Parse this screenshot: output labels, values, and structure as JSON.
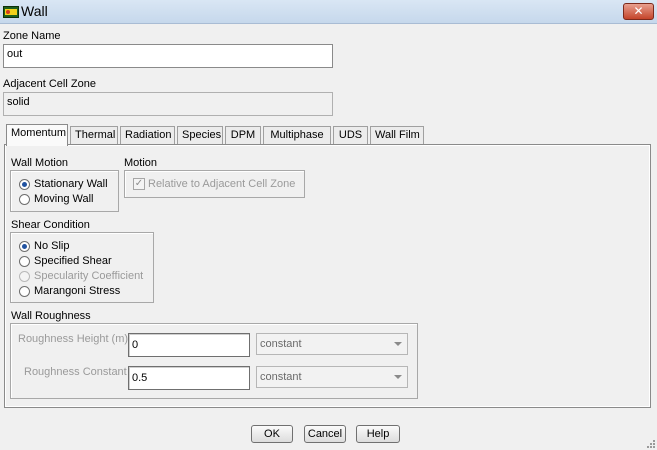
{
  "window": {
    "title": "Wall",
    "close_label": "✕"
  },
  "zone_name": {
    "label": "Zone Name",
    "value": "out"
  },
  "adjacent_cell_zone": {
    "label": "Adjacent Cell Zone",
    "value": "solid"
  },
  "tabs": [
    {
      "label": "Momentum",
      "active": true
    },
    {
      "label": "Thermal"
    },
    {
      "label": "Radiation"
    },
    {
      "label": "Species"
    },
    {
      "label": "DPM"
    },
    {
      "label": "Multiphase"
    },
    {
      "label": "UDS"
    },
    {
      "label": "Wall Film"
    }
  ],
  "momentum": {
    "wall_motion": {
      "label": "Wall Motion",
      "options": [
        "Stationary Wall",
        "Moving Wall"
      ],
      "selected": "Stationary Wall"
    },
    "motion": {
      "label": "Motion",
      "relative_label": "Relative to Adjacent Cell Zone",
      "relative_checked": true
    },
    "shear_condition": {
      "label": "Shear Condition",
      "options": [
        "No Slip",
        "Specified Shear",
        "Specularity Coefficient",
        "Marangoni Stress"
      ],
      "selected": "No Slip"
    },
    "wall_roughness": {
      "label": "Wall Roughness",
      "height": {
        "label": "Roughness Height (m)",
        "value": "0",
        "method": "constant"
      },
      "constant": {
        "label": "Roughness Constant",
        "value": "0.5",
        "method": "constant"
      }
    }
  },
  "buttons": {
    "ok": "OK",
    "cancel": "Cancel",
    "help": "Help"
  }
}
